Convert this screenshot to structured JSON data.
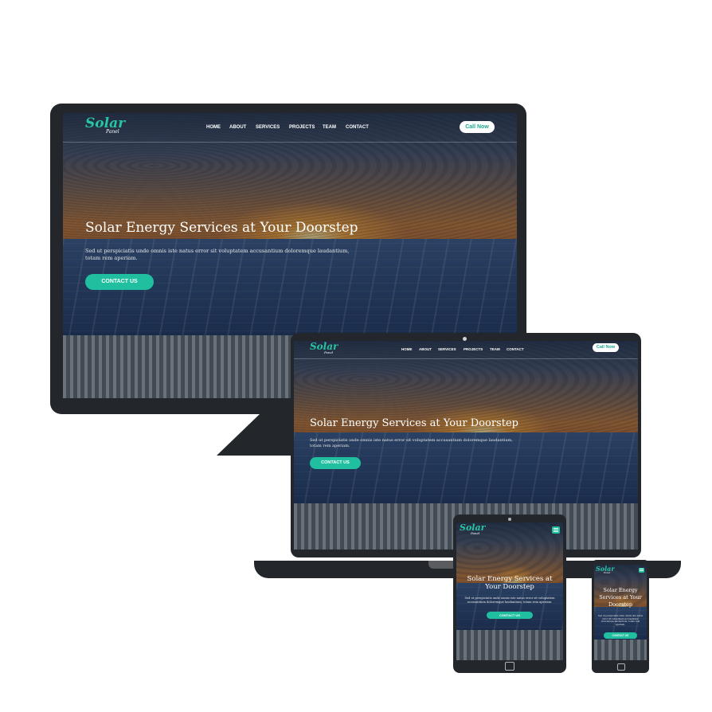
{
  "site": {
    "logo_text": "Solar",
    "logo_sub": "Panel",
    "nav": [
      "HOME",
      "ABOUT",
      "SERVICES",
      "PROJECTS",
      "TEAM",
      "CONTACT"
    ],
    "call_label": "Call Now",
    "hero_title": "Solar Energy Services at Your Doorstep",
    "hero_text": "Sed ut perspiciatis unde omnis iste natus error sit voluptatem accusantium doloremque laudantium, totam rem aperiam.",
    "cta_label": "CONTACT US"
  },
  "colors": {
    "accent": "#1fbf9f",
    "device_frame": "#23262b",
    "logo": "#27c4a6"
  },
  "icons": [
    "menu-icon",
    "home-button-icon",
    "camera-dot-icon"
  ]
}
